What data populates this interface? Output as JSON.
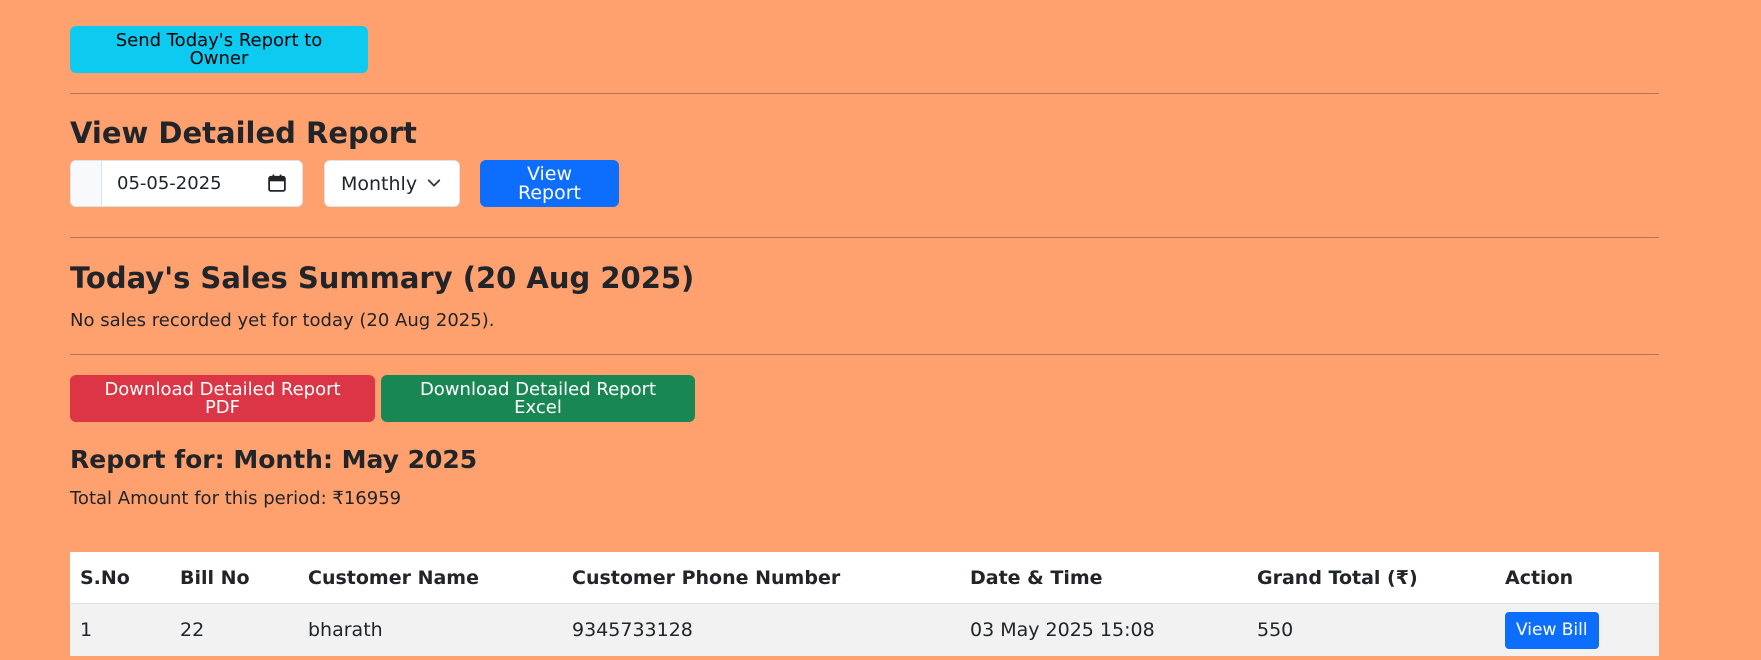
{
  "actions": {
    "send_report_label": "Send Today's Report to Owner"
  },
  "detailed_report": {
    "title": "View Detailed Report",
    "date_value": "05-05-2025",
    "period_selected": "Monthly",
    "view_report_label": "View Report"
  },
  "summary": {
    "title": "Today's Sales Summary (20 Aug 2025)",
    "message": "No sales recorded yet for today (20 Aug 2025)."
  },
  "downloads": {
    "pdf_label": "Download Detailed Report PDF",
    "excel_label": "Download Detailed Report Excel"
  },
  "report": {
    "heading": "Report for: Month: May 2025",
    "total_text": "Total Amount for this period: ₹16959"
  },
  "table": {
    "headers": [
      "S.No",
      "Bill No",
      "Customer Name",
      "Customer Phone Number",
      "Date & Time",
      "Grand Total (₹)",
      "Action"
    ],
    "rows": [
      {
        "sno": "1",
        "bill_no": "22",
        "customer_name": "bharath",
        "phone": "9345733128",
        "datetime": "03 May 2025 15:08",
        "grand_total": "550",
        "action_label": "View Bill"
      }
    ]
  },
  "colors": {
    "background": "#ffa06f",
    "info": "#0dcaf0",
    "primary": "#0d6efd",
    "danger": "#dc3545",
    "success": "#198754"
  }
}
